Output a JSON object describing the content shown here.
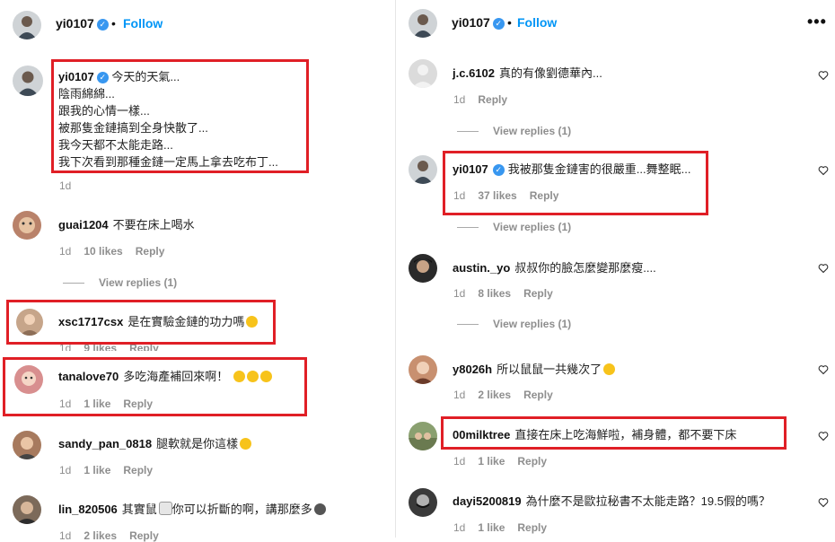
{
  "left": {
    "header": {
      "username": "yi0107",
      "separator": "•",
      "follow_label": "Follow"
    },
    "post": {
      "username": "yi0107",
      "caption_lines": [
        "今天的天氣...",
        "陰雨綿綿...",
        "跟我的心情一樣...",
        "被那隻金鏈搞到全身快散了...",
        "我今天都不太能走路...",
        "我下次看到那種金鏈一定馬上拿去吃布丁..."
      ],
      "time": "1d"
    },
    "comments": [
      {
        "username": "guai1204",
        "text": "不要在床上喝水",
        "time": "1d",
        "likes": "10 likes",
        "reply": "Reply",
        "view_replies": "View replies (1)",
        "avatar_color": "#b9826a"
      },
      {
        "username": "xsc1717csx",
        "text": "是在實驗金鏈的功力嗎",
        "time": "1d",
        "likes": "9 likes",
        "reply": "Reply",
        "avatar_color": "#c6a58a"
      },
      {
        "username": "tanalove70",
        "text": "多吃海產補回來啊！",
        "time": "1d",
        "likes": "1 like",
        "reply": "Reply",
        "avatar_color": "#d88f8f"
      },
      {
        "username": "sandy_pan_0818",
        "text": "腿軟就是你這樣",
        "time": "1d",
        "likes": "1 like",
        "reply": "Reply",
        "avatar_color": "#a77a5e"
      },
      {
        "username": "lin_820506",
        "text": "其實鼠",
        "text2": "你可以折斷的啊，講那麼多",
        "time": "1d",
        "likes": "2 likes",
        "reply": "Reply",
        "avatar_color": "#7c6a5a"
      }
    ]
  },
  "right": {
    "header": {
      "username": "yi0107",
      "separator": "•",
      "follow_label": "Follow",
      "more_label": "•••"
    },
    "comments": [
      {
        "username": "j.c.6102",
        "text": "真的有像劉德華內...",
        "time": "1d",
        "reply": "Reply",
        "view_replies": "View replies (1)",
        "avatar_color": "#d8d8d8"
      },
      {
        "username": "yi0107",
        "text": "我被那隻金鏈害的很嚴重...舞整眠...",
        "time": "1d",
        "likes": "37 likes",
        "reply": "Reply",
        "view_replies": "View replies (1)",
        "avatar_color": "#777777"
      },
      {
        "username": "austin._yo",
        "text": "叔叔你的臉怎麼變那麼瘦....",
        "time": "1d",
        "likes": "8 likes",
        "reply": "Reply",
        "view_replies": "View replies (1)",
        "avatar_color": "#2a2a2a"
      },
      {
        "username": "y8026h",
        "text": "所以鼠鼠一共幾次了",
        "time": "1d",
        "likes": "2 likes",
        "reply": "Reply",
        "avatar_color": "#c89070"
      },
      {
        "username": "00milktree",
        "text": "直接在床上吃海鮮啦，補身體，都不要下床",
        "time": "1d",
        "likes": "1 like",
        "reply": "Reply",
        "avatar_color": "#8aa070"
      },
      {
        "username": "dayi5200819",
        "text": "為什麼不是歐拉秘書不太能走路？19.5假的嗎？",
        "time": "1d",
        "likes": "1 like",
        "reply": "Reply",
        "avatar_color": "#3a3a3a"
      }
    ]
  },
  "colors": {
    "accent": "#0095f6",
    "highlight_box": "#e01f26",
    "verified": "#3897f0",
    "muted": "#8e8e8e"
  }
}
